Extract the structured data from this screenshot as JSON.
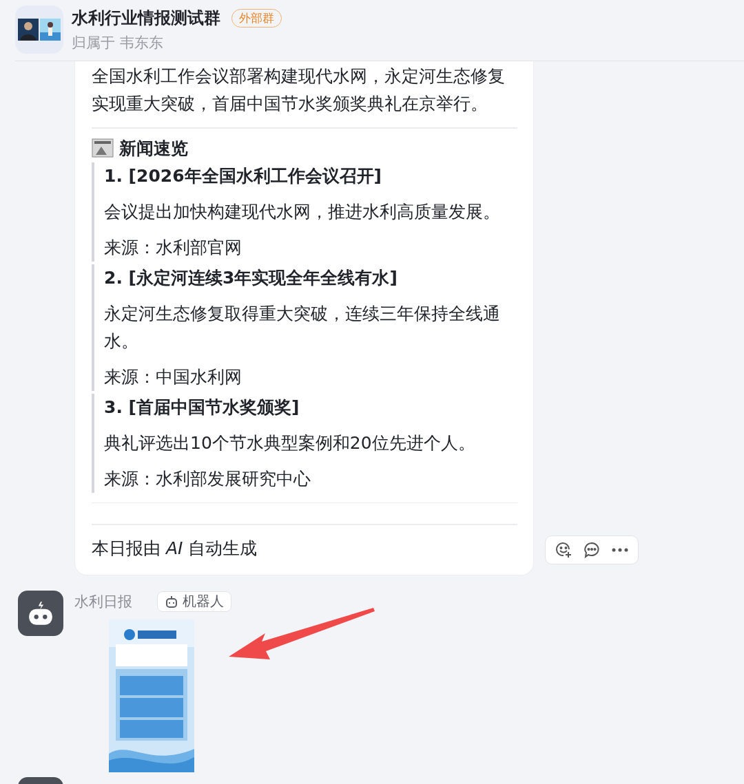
{
  "chat": {
    "title": "水利行业情报测试群",
    "tag": "外部群",
    "owner": "归属于 韦东东"
  },
  "report_card": {
    "summary": "全国水利工作会议部署构建现代水网，永定河生态修复实现重大突破，首届中国节水奖颁奖典礼在京举行。",
    "news_heading": "新闻速览",
    "news": [
      {
        "title": "1. [2026年全国水利工作会议召开]",
        "body": "会议提出加快构建现代水网，推进水利高质量发展。",
        "source": "来源：水利部官网"
      },
      {
        "title": "2. [永定河连续3年实现全年全线有水]",
        "body": "永定河生态修复取得重大突破，连续三年保持全线通水。",
        "source": "来源：中国水利网"
      },
      {
        "title": "3. [首届中国节水奖颁奖]",
        "body": "典礼评选出10个节水典型案例和20位先进个人。",
        "source": "来源：水利部发展研究中心"
      }
    ],
    "footer": "本日报由 *AI* 自动生成"
  },
  "bot_message": {
    "sender": "水利日报",
    "badge": "机器人"
  }
}
